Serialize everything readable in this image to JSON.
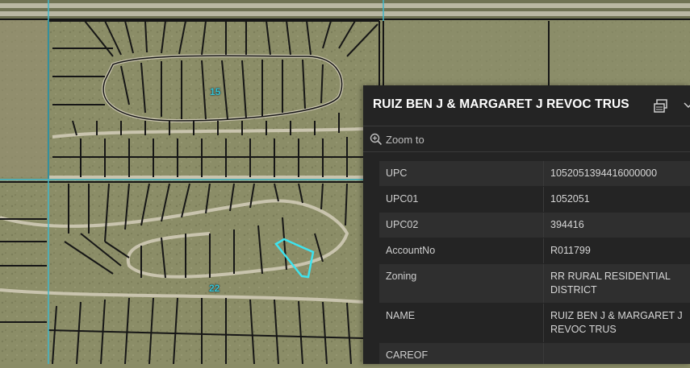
{
  "map": {
    "section_labels": [
      "15",
      "22"
    ],
    "colors": {
      "parcel_line": "#161616",
      "road": "#c9c4ae",
      "section_line": "#3fb7cc",
      "selection": "#3ee3ee",
      "terrain": "#8a8c66"
    }
  },
  "popup": {
    "title": "RUIZ BEN J & MARGARET J REVOC TRUS",
    "zoom_to_label": "Zoom to",
    "dock_icon": "dock-icon",
    "collapse_icon": "chevron-down-icon",
    "attributes": [
      {
        "key": "UPC",
        "value": "1052051394416000000"
      },
      {
        "key": "UPC01",
        "value": "1052051"
      },
      {
        "key": "UPC02",
        "value": "394416"
      },
      {
        "key": "AccountNo",
        "value": "R011799"
      },
      {
        "key": "Zoning",
        "value": "RR RURAL RESIDENTIAL DISTRICT"
      },
      {
        "key": "NAME",
        "value": "RUIZ BEN J & MARGARET J REVOC TRUS"
      },
      {
        "key": "CAREOF",
        "value": ""
      }
    ]
  }
}
